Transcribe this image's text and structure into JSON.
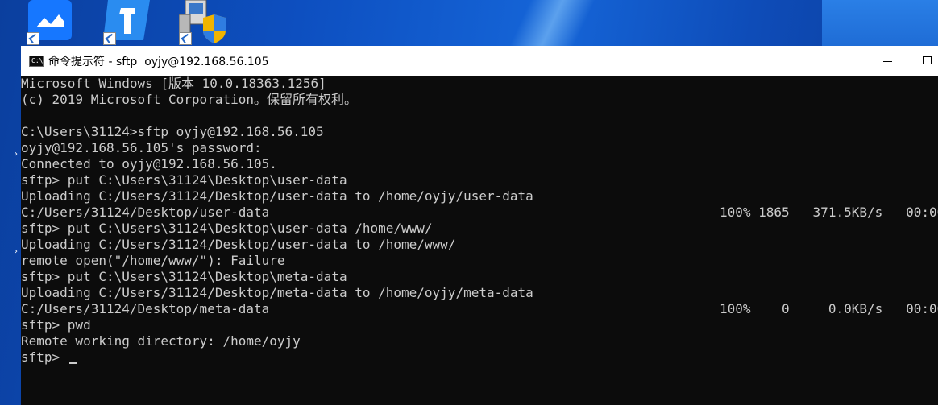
{
  "window": {
    "title": "命令提示符 - sftp  oyjy@192.168.56.105",
    "app_icon": "C:\\",
    "controls": [
      "minimize-icon",
      "maximize-icon"
    ]
  },
  "desktop": {
    "icons": [
      "feishu-app-icon",
      "dingtalk-app-icon",
      "installer-app-icon"
    ]
  },
  "console": {
    "lines": [
      "Microsoft Windows [版本 10.0.18363.1256]",
      "(c) 2019 Microsoft Corporation。保留所有权利。",
      "",
      "C:\\Users\\31124>sftp oyjy@192.168.56.105",
      "oyjy@192.168.56.105's password:",
      "Connected to oyjy@192.168.56.105.",
      "sftp> put C:\\Users\\31124\\Desktop\\user-data",
      "Uploading C:/Users/31124/Desktop/user-data to /home/oyjy/user-data",
      "C:/Users/31124/Desktop/user-data                                                          100% 1865   371.5KB/s   00:00",
      "sftp> put C:\\Users\\31124\\Desktop\\user-data /home/www/",
      "Uploading C:/Users/31124/Desktop/user-data to /home/www/",
      "remote open(\"/home/www/\"): Failure",
      "sftp> put C:\\Users\\31124\\Desktop\\meta-data",
      "Uploading C:/Users/31124/Desktop/meta-data to /home/oyjy/meta-data",
      "C:/Users/31124/Desktop/meta-data                                                          100%    0     0.0KB/s   00:00",
      "sftp> pwd",
      "Remote working directory: /home/oyjy",
      "sftp> "
    ]
  },
  "colors": {
    "console_bg": "#0c0c0c",
    "console_fg": "#cccccc",
    "desktop_bg": "#0d4fc0"
  }
}
